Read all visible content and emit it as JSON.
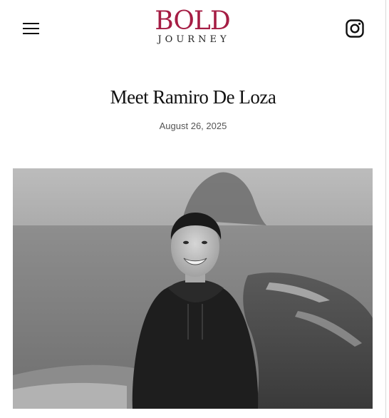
{
  "header": {
    "logo": {
      "main": "BOLD",
      "sub": "JOURNEY"
    },
    "menu_icon": "hamburger-menu-icon",
    "social_icon": "instagram-icon"
  },
  "article": {
    "title": "Meet Ramiro De Loza",
    "date": "August 26, 2025",
    "hero_photo": "black-and-white-portrait-photo"
  },
  "colors": {
    "brand": "#a51d44",
    "text": "#111111",
    "meta": "#555555"
  }
}
